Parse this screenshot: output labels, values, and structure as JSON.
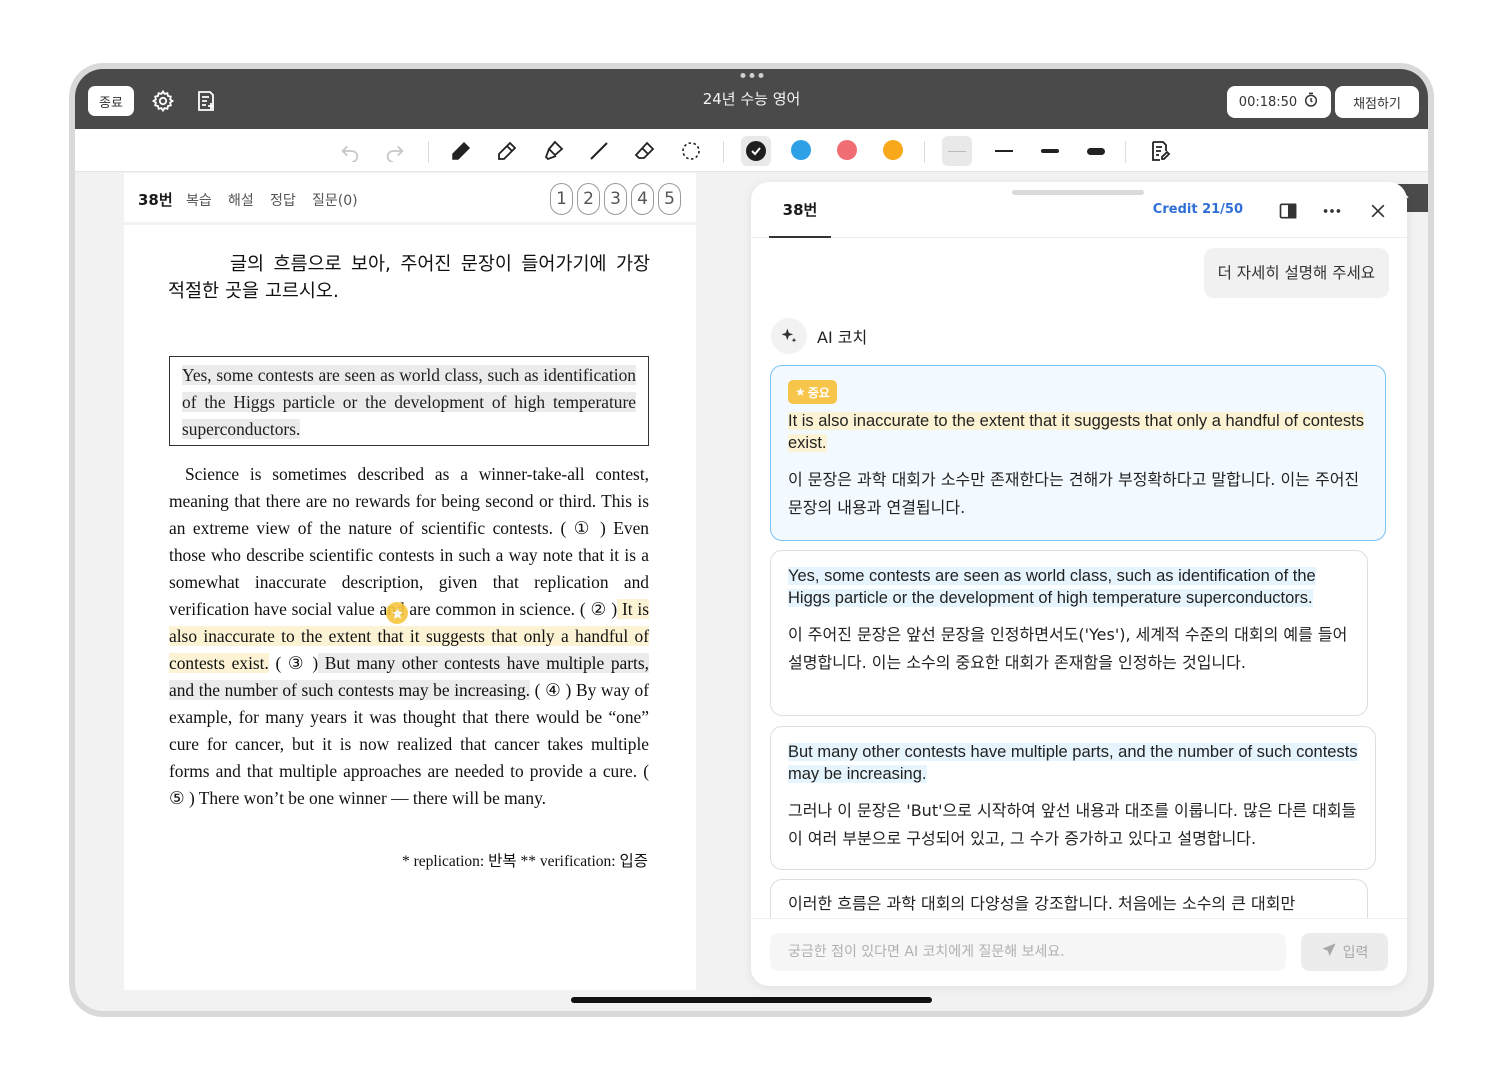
{
  "topbar": {
    "exit_label": "종료",
    "title": "24년 수능 영어",
    "timer": "00:18:50",
    "grade_label": "채점하기"
  },
  "toolbar": {
    "colors": {
      "black": "#1f1f1f",
      "blue": "#2ea1e6",
      "red": "#f06e73",
      "orange": "#f7a81b"
    }
  },
  "question_nav": {
    "number": "38번",
    "links": [
      "복습",
      "해설",
      "정답",
      "질문(0)"
    ],
    "choices": [
      "1",
      "2",
      "3",
      "4",
      "5"
    ]
  },
  "question": {
    "prompt": "글의 흐름으로 보아, 주어진 문장이 들어가기에 가장 적절한 곳을 고르시오.",
    "given_sentence": "Yes, some contests are seen as world class, such as identification of the Higgs particle or the development of high temperature superconductors.",
    "passage": {
      "s1": "Science is sometimes described as a winner-take-all contest, meaning that there are no rewards for being second or third. This is an extreme view of the nature of scientific contests. ",
      "m1": "( ① )",
      "s2": " Even those who describe scientific contests in such a way note that it is a somewhat inaccurate description, given that replication and verification have social value and are common in science. ",
      "m2": "( ② )",
      "s3_hl": " It is also inaccurate to the extent that it suggests that only a handful of contests exist.",
      "m3": " ( ③ )",
      "s4_hl": " But many other contests have multiple parts, and the number of such contests may be increasing.",
      "m4": " ( ④ )",
      "s5": " By way of example, for many years it was thought that there would be “one” cure for cancer, but it is now realized that cancer takes multiple forms and that multiple approaches are needed to provide a cure. ",
      "m5": "( ⑤ )",
      "s6": " There won’t be one winner — there will be many."
    },
    "footnote": "* replication: 반복   ** verification: 입증"
  },
  "ai_panel": {
    "tab": "38번",
    "credit": "Credit 21/50",
    "user_message": "더 자세히 설명해 주세요",
    "coach_name": "AI 코치",
    "cards": [
      {
        "badge": "중요",
        "en": "It is also inaccurate to the extent that it suggests that only a handful of contests exist.",
        "ko": "이 문장은 과학 대회가 소수만 존재한다는 견해가 부정확하다고 말합니다. 이는 주어진 문장의 내용과 연결됩니다."
      },
      {
        "en": "Yes, some contests are seen as world class, such as identification of the Higgs particle or the development of high temperature superconductors.",
        "ko": "이 주어진 문장은 앞선 문장을 인정하면서도('Yes'), 세계적 수준의 대회의 예를 들어 설명합니다. 이는 소수의 중요한 대회가 존재함을 인정하는 것입니다."
      },
      {
        "en": "But many other contests have multiple parts, and the number of such contests may be increasing.",
        "ko": "그러나 이 문장은 'But'으로 시작하여 앞선 내용과 대조를 이룹니다. 많은 다른 대회들이 여러 부분으로 구성되어 있고, 그 수가 증가하고 있다고 설명합니다."
      },
      {
        "ko": "이러한 흐름은 과학 대회의 다양성을 강조합니다. 처음에는 소수의 큰 대회만"
      }
    ],
    "input_placeholder": "궁금한 점이 있다면 AI 코치에게 질문해 보세요.",
    "send_label": "입력"
  }
}
